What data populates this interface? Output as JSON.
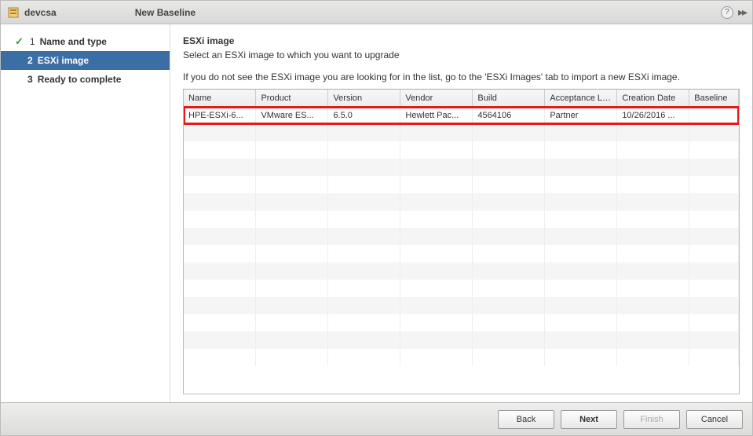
{
  "title": {
    "host": "devcsa",
    "dialog": "New Baseline"
  },
  "steps": [
    {
      "num": "1",
      "label": "Name and type",
      "state": "completed"
    },
    {
      "num": "2",
      "label": "ESXi image",
      "state": "active"
    },
    {
      "num": "3",
      "label": "Ready to complete",
      "state": "pending"
    }
  ],
  "main": {
    "heading": "ESXi image",
    "subtext": "Select an ESXi image to which you want to upgrade",
    "info": "If you do not see the ESXi image you are looking for in the list, go to the 'ESXi Images' tab to import a new ESXi image."
  },
  "table": {
    "headers": [
      "Name",
      "Product",
      "Version",
      "Vendor",
      "Build",
      "Acceptance Le...",
      "Creation Date",
      "Baseline"
    ],
    "row": {
      "name": "HPE-ESXi-6...",
      "product": "VMware ES...",
      "version": "6.5.0",
      "vendor": "Hewlett Pac...",
      "build": "4564106",
      "acceptance": "Partner",
      "date": "10/26/2016 ...",
      "baseline": ""
    }
  },
  "buttons": {
    "back": "Back",
    "next": "Next",
    "finish": "Finish",
    "cancel": "Cancel"
  }
}
